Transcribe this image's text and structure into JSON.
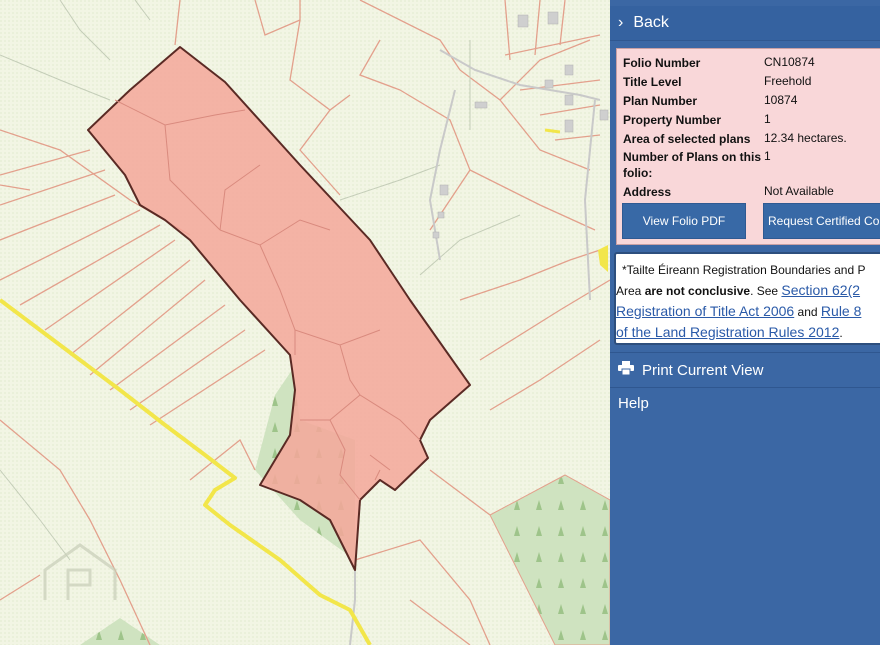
{
  "panel": {
    "back_label": "Back",
    "print_label": "Print Current View",
    "help_label": "Help"
  },
  "folio": {
    "rows": [
      {
        "label": "Folio Number",
        "value": "CN10874"
      },
      {
        "label": "Title Level",
        "value": "Freehold"
      },
      {
        "label": "Plan Number",
        "value": "10874"
      },
      {
        "label": "Property Number",
        "value": "1"
      },
      {
        "label": "Area of selected plans",
        "value": "12.34 hectares."
      },
      {
        "label": "Number of Plans on this folio:",
        "value": "1"
      },
      {
        "label": "Address",
        "value": "Not Available"
      }
    ],
    "view_pdf_label": "View Folio PDF",
    "request_copy_label": "Request Certified Co"
  },
  "note": {
    "line1": "*Tailte Éireann Registration Boundaries and P",
    "line2_a": "Area ",
    "line2_bold": "are not conclusive",
    "line2_b": ". See ",
    "link1_part1": "Section 62(2",
    "link1_part2": "Registration of Title Act 2006",
    "and": " and ",
    "link2_part1": "Rule 8",
    "link2_part2": "of the Land Registration Rules 2012",
    "period": "."
  },
  "map": {
    "colors": {
      "background": "#f2f5e4",
      "field_border": "#e3a08c",
      "parcel_fill": "#f4a79a",
      "parcel_border": "#5a2a24",
      "road": "#f2e64a",
      "woodland": "#cfe3c0"
    }
  }
}
